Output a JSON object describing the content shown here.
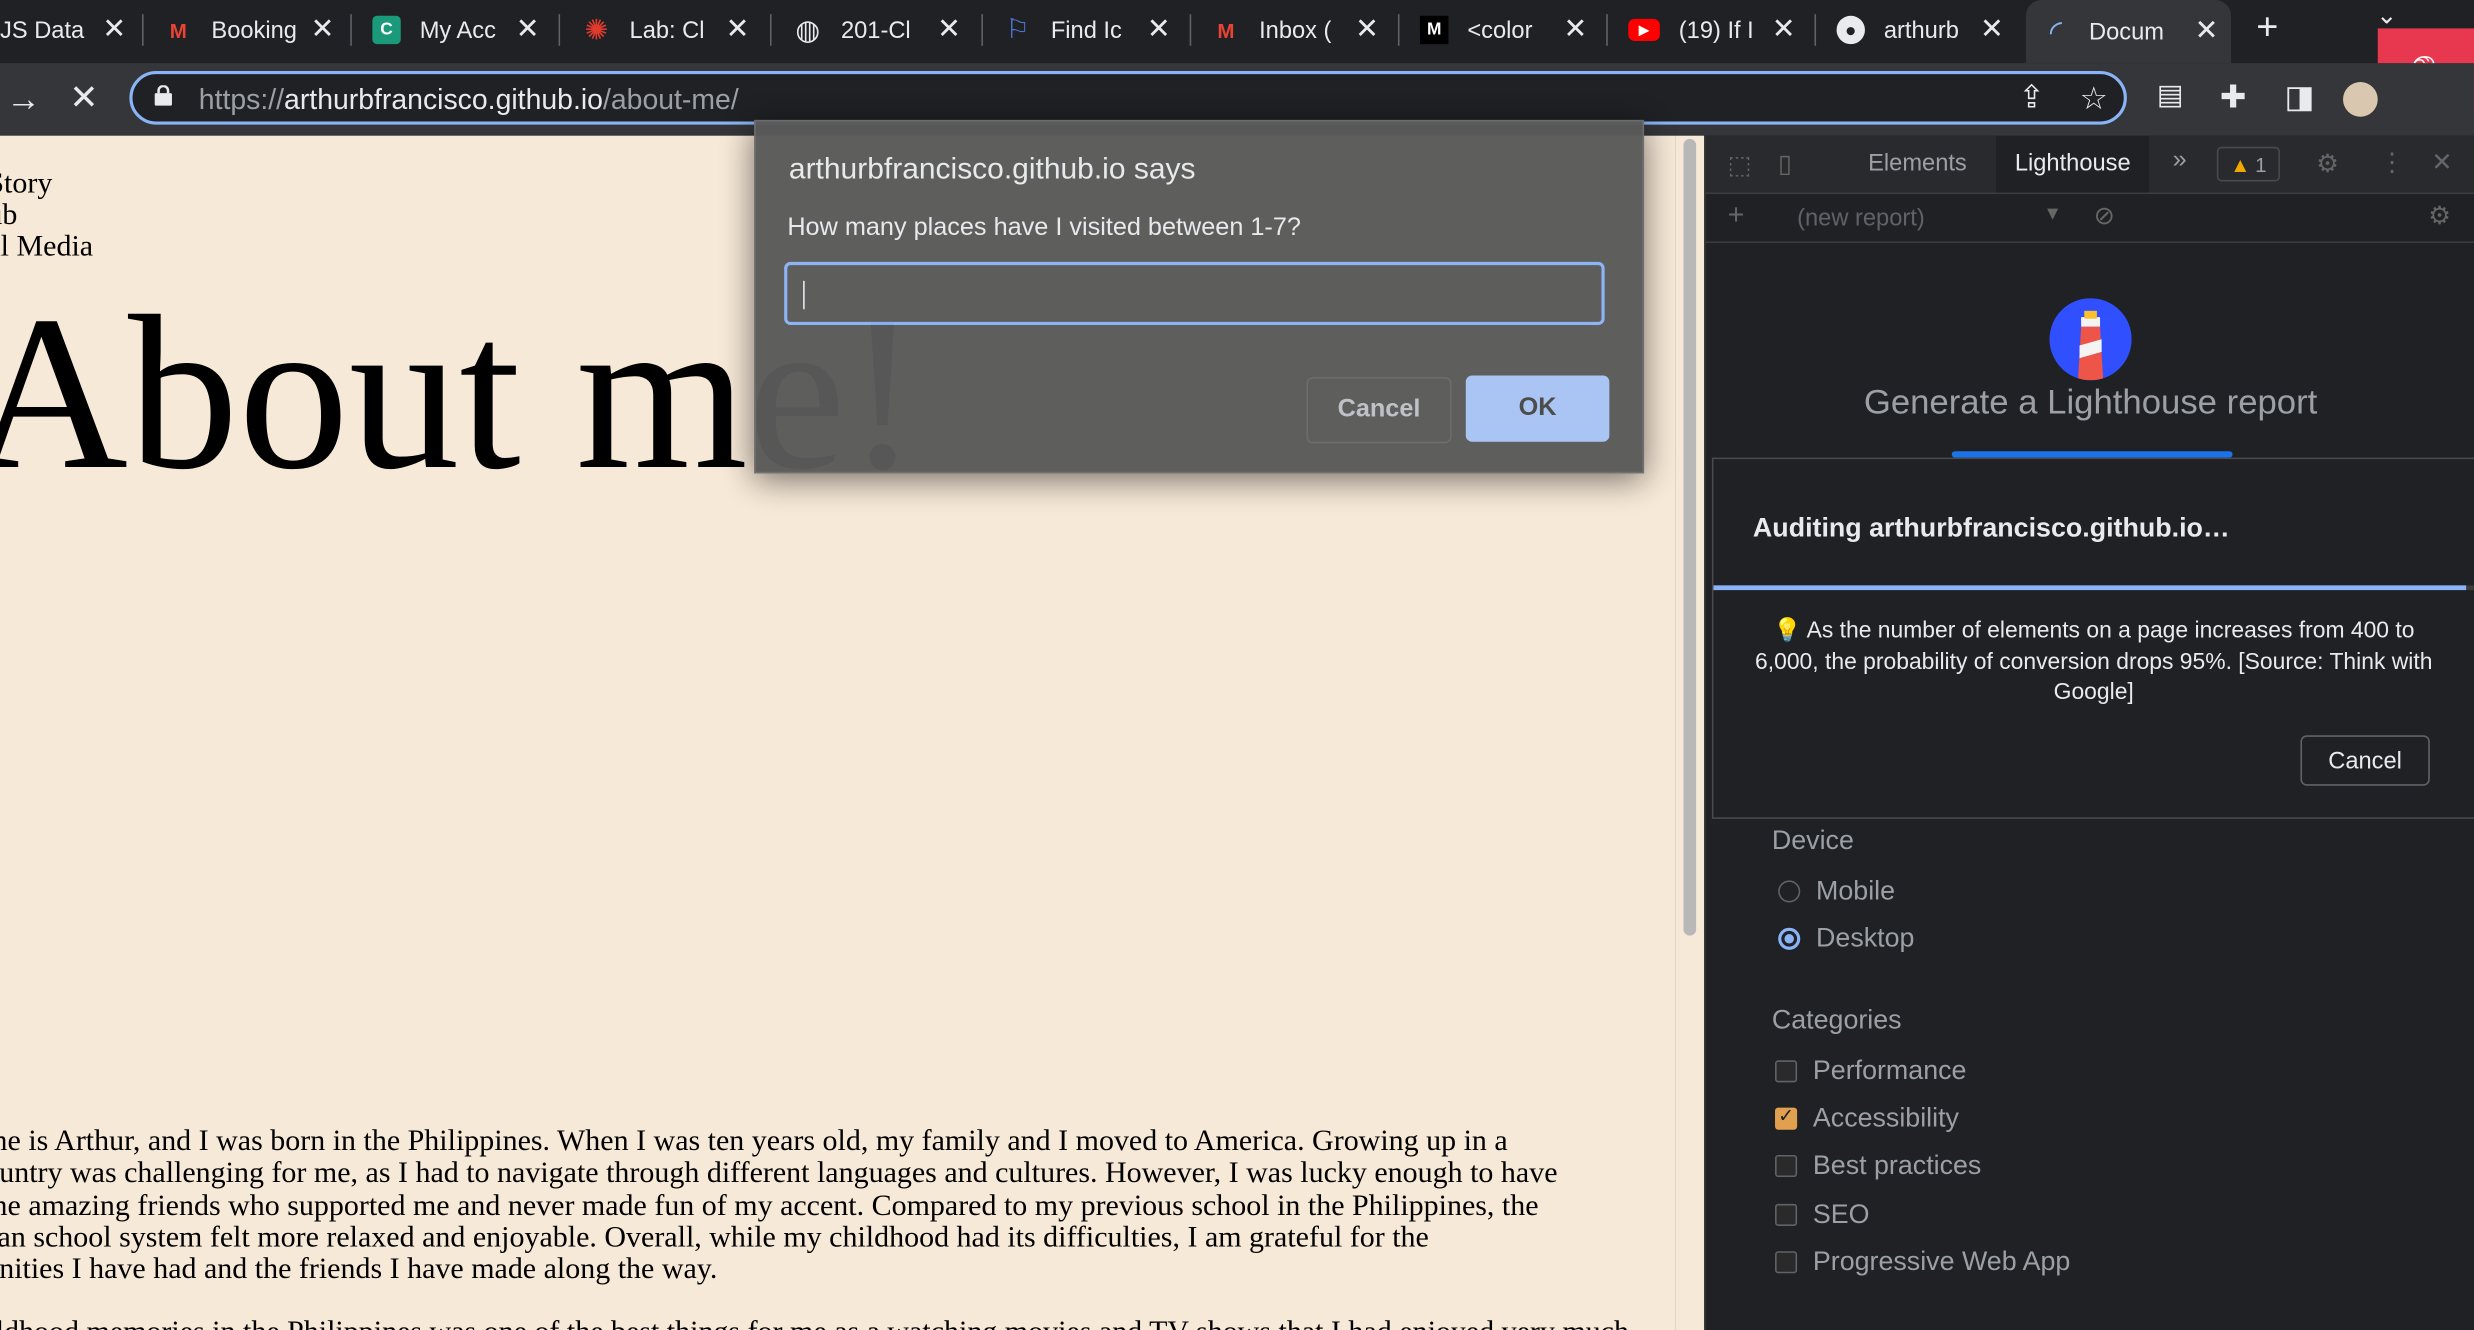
{
  "tabs": [
    {
      "label": "JS Data",
      "icon": ""
    },
    {
      "label": "Booking",
      "icon": "gmail-icon"
    },
    {
      "label": "My Acc",
      "icon": "cc-icon"
    },
    {
      "label": "Lab: Cl",
      "icon": "canvas-icon"
    },
    {
      "label": "201-Cl",
      "icon": "globe-icon"
    },
    {
      "label": "Find Ic",
      "icon": "flag-icon"
    },
    {
      "label": "Inbox (",
      "icon": "gmail-icon"
    },
    {
      "label": "<color",
      "icon": "m-icon"
    },
    {
      "label": "(19) If I",
      "icon": "youtube-icon"
    },
    {
      "label": "arthurb",
      "icon": "github-icon"
    },
    {
      "label": "Docum",
      "icon": "loading-icon"
    }
  ],
  "omnibox": {
    "url_prefix": "https://",
    "url_host": "arthurbfrancisco.github.io",
    "url_path": "/about-me/"
  },
  "page": {
    "nav": [
      "Story",
      "ub",
      "al Media"
    ],
    "heading": "About me!",
    "paragraph_lines": [
      "me is Arthur, and I was born in the Philippines. When I was ten years old, my family and I moved to America. Growing up in a",
      "ountry was challenging for me, as I had to navigate through different languages and cultures. However, I was lucky enough to have",
      "me amazing friends who supported me and never made fun of my accent. Compared to my previous school in the Philippines, the",
      "can school system felt more relaxed and enjoyable. Overall, while my childhood had its difficulties, I am grateful for the",
      "unities I have had and the friends I have made along the way."
    ],
    "paragraph2": "ildhood memories in the Philippines was one of the best things for me as a watching movies and TV shows that I had enjoyed very much"
  },
  "dialog": {
    "title": "arthurbfrancisco.github.io says",
    "message": "How many places have I visited between 1-7?",
    "input_value": "",
    "cancel_label": "Cancel",
    "ok_label": "OK"
  },
  "devtools": {
    "tabs": {
      "elements": "Elements",
      "lighthouse": "Lighthouse"
    },
    "warning_count": "1",
    "new_report": "(new report)",
    "lighthouse_title": "Generate a Lighthouse report",
    "audit": {
      "title": "Auditing arthurbfrancisco.github.io…",
      "tip": "As the number of elements on a page increases from 400 to 6,000, the probability of conversion drops 95%. [Source: Think with Google]",
      "cancel_label": "Cancel",
      "progress": 0.99
    },
    "device_label": "Device",
    "devices": [
      {
        "label": "Mobile",
        "selected": false
      },
      {
        "label": "Desktop",
        "selected": true
      }
    ],
    "categories_label": "Categories",
    "categories": [
      {
        "label": "Performance",
        "checked": false
      },
      {
        "label": "Accessibility",
        "checked": true
      },
      {
        "label": "Best practices",
        "checked": false
      },
      {
        "label": "SEO",
        "checked": false
      },
      {
        "label": "Progressive Web App",
        "checked": false
      }
    ]
  },
  "colors": {
    "page_bg": "#f7e9d7",
    "accent": "#8ab4f8",
    "mic_bg": "#e8384f"
  }
}
